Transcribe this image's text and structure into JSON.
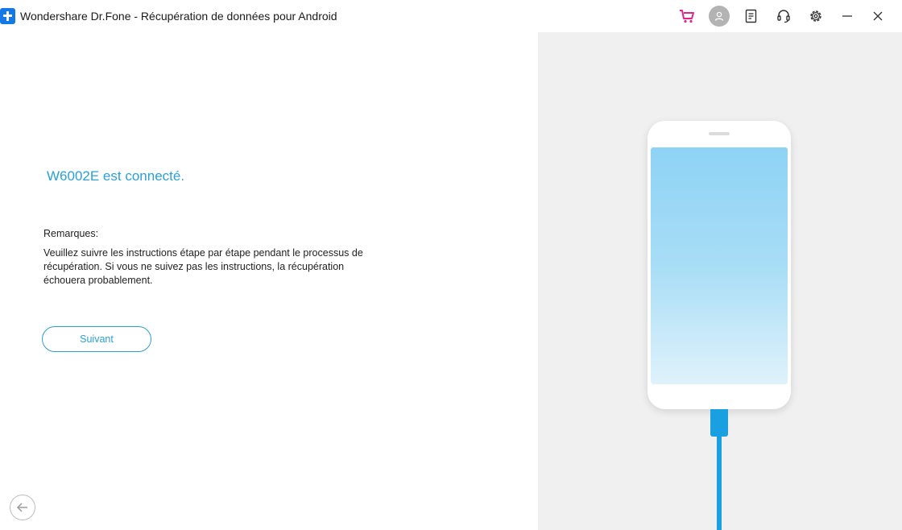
{
  "window": {
    "title": "Wondershare Dr.Fone - Récupération de données pour Android"
  },
  "toolbar": {
    "icons": [
      "cart-icon",
      "user-avatar-icon",
      "notes-icon",
      "headset-support-icon",
      "gear-icon",
      "minimize-icon",
      "close-icon"
    ],
    "cart_color": "#e0258a"
  },
  "main": {
    "connected_message": "W6002E est connecté.",
    "notes_label": "Remarques:",
    "notes_text": "Veuillez suivre les instructions étape par étape pendant le processus de récupération. Si vous ne suivez pas les instructions, la récupération échouera probablement.",
    "next_button_label": "Suivant"
  },
  "colors": {
    "accent": "#2aa0d8",
    "cable": "#1aa0e0",
    "right_panel_bg": "#f0f0f0"
  }
}
